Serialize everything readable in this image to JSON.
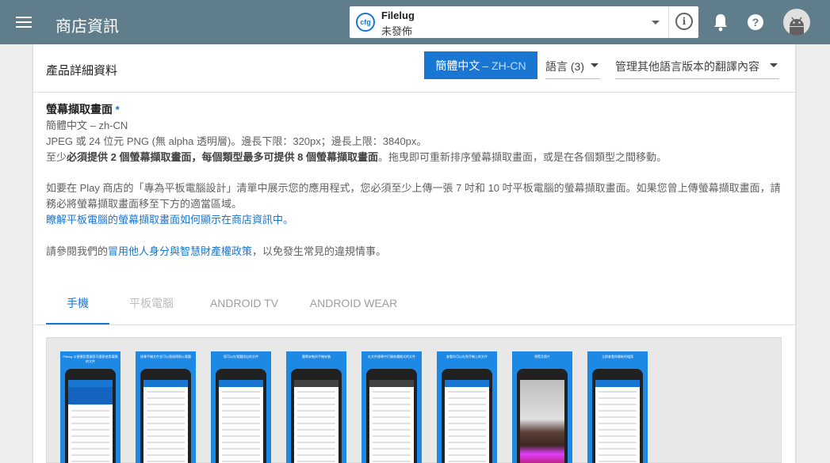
{
  "header": {
    "title": "商店資訊",
    "app": {
      "name": "Filelug",
      "status": "未發佈",
      "icon_label": "cfg"
    },
    "info_label": "i",
    "help_label": "?"
  },
  "card": {
    "section_title": "產品詳細資料",
    "lang_button": {
      "name": "簡體中文",
      "code": "– ZH-CN"
    },
    "languages_dropdown": "語言 (3)",
    "manage_dropdown": "管理其他語言版本的翻譯內容"
  },
  "content": {
    "field_title": "螢幕擷取畫面",
    "required_mark": "*",
    "language": "簡體中文 – zh-CN",
    "format": "JPEG 或 24 位元 PNG (無 alpha 透明層)。邊長下限：320px；邊長上限：3840px。",
    "req_prefix": "至少",
    "req_bold1": "必須提供 2 個螢幕擷取畫面",
    "req_sep": "，",
    "req_bold2": "每個類型最多可提供 8 個螢幕擷取畫面",
    "req_suffix": "。拖曳即可重新排序螢幕擷取畫面，或是在各個類型之間移動。",
    "tablet_note": "如要在 Play 商店的「專為平板電腦設計」清單中展示您的應用程式，您必須至少上傳一張 7 吋和 10 吋平板電腦的螢幕擷取畫面。如果您曾上傳螢幕擷取畫面，請務必將螢幕擷取畫面移至下方的適當區域。",
    "tablet_link": "瞭解平板電腦的螢幕擷取畫面如何顯示在商店資訊中。",
    "policy_prefix": "請參閱我們的",
    "policy_link": "冒用他人身分與智慧財產權政策",
    "policy_suffix": "，以免發生常見的違規情事。"
  },
  "tabs": [
    "手機",
    "平板電腦",
    "ANDROID TV",
    "ANDROID WEAR"
  ],
  "screenshots": [
    {
      "caption": "Filelug 以便捷設置讓您可隨意使用電腦的文件"
    },
    {
      "caption": "搜尋手機文件並可以直接傳到公電腦"
    },
    {
      "caption": "您可以在電腦找出的文件"
    },
    {
      "caption": "簡單安裝與手機安裝"
    },
    {
      "caption": "在文件搜尋中打開各種格式的文件"
    },
    {
      "caption": "查看你可以存到手機上的文件"
    },
    {
      "caption": "預覽及照片"
    },
    {
      "caption": "立即查看你最新的檔案"
    }
  ],
  "colors": {
    "topbar": "#607d8b",
    "accent": "#1976d2",
    "shot_bg": "#1e88e5"
  }
}
